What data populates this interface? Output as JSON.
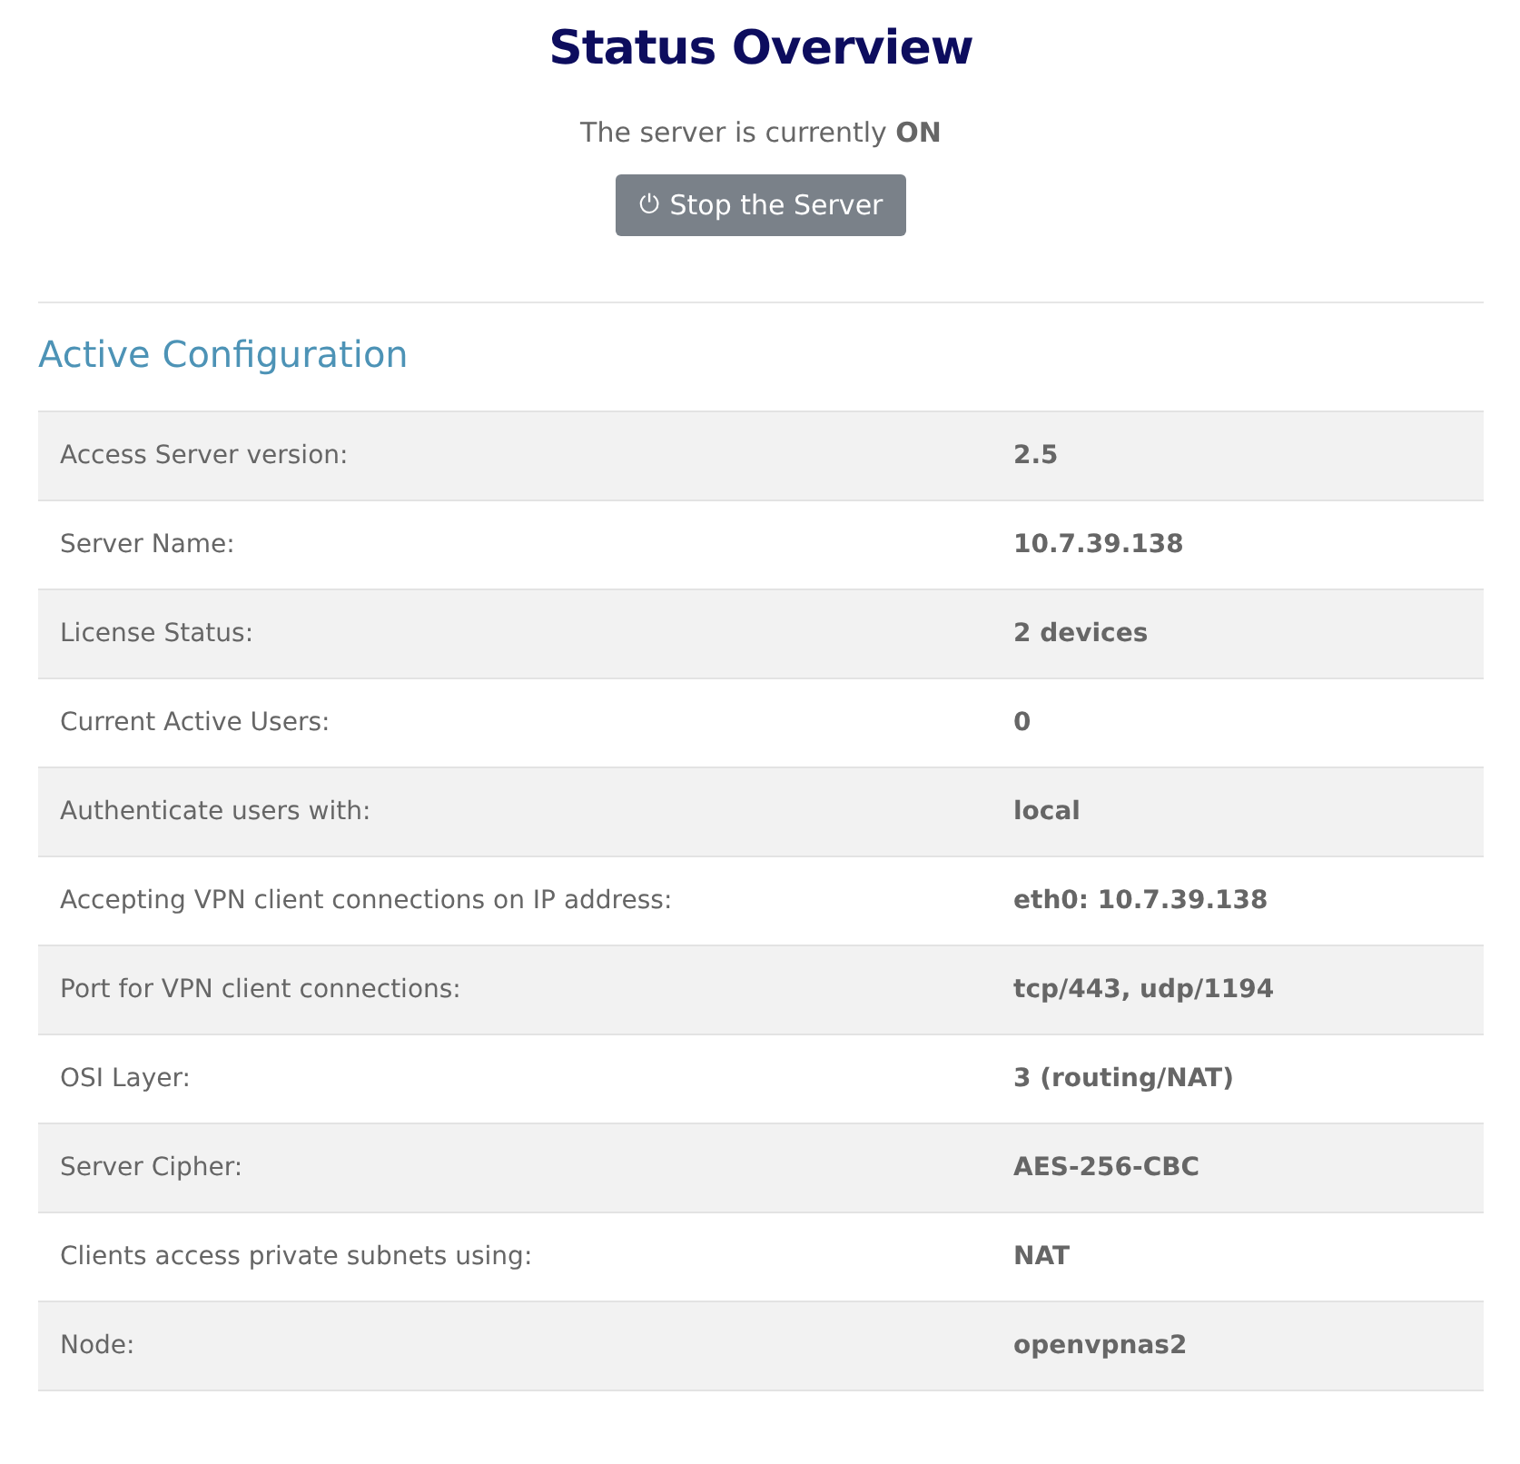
{
  "title": "Status Overview",
  "status_text": "The server is currently **ON**",
  "stop_button": {
    "icon": "⏻",
    "label": "Stop the Server"
  },
  "section_title": "Active Configuration",
  "rows": [
    {
      "label": "Access Server version:",
      "value": "2.5"
    },
    {
      "label": "Server Name:",
      "value": "10.7.39.138"
    },
    {
      "label": "License Status:",
      "value": "2 devices"
    },
    {
      "label": "Current Active Users:",
      "value": "0"
    },
    {
      "label": "Authenticate users with:",
      "value": "local"
    },
    {
      "label": "Accepting VPN client connections on IP address:",
      "value": "eth0: 10.7.39.138"
    },
    {
      "label": "Port for VPN client connections:",
      "value": "tcp/443, udp/1194"
    },
    {
      "label": "OSI Layer:",
      "value": "3 (routing/NAT)"
    },
    {
      "label": "Server Cipher:",
      "value": "AES-256-CBC"
    },
    {
      "label": "Clients access private subnets using:",
      "value": "NAT"
    },
    {
      "label": "Node:",
      "value": "openvpnas2"
    }
  ]
}
